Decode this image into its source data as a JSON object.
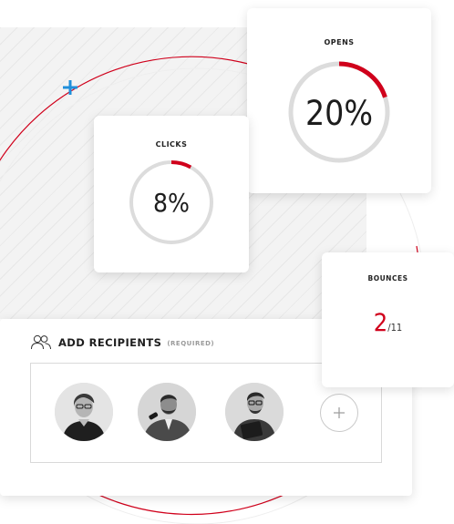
{
  "colors": {
    "accent": "#d0001b",
    "ring_track": "#dcdcdc",
    "cursor": "#1f8fdb"
  },
  "metrics": {
    "opens": {
      "label": "OPENS",
      "value": "20%",
      "fraction": 0.2
    },
    "clicks": {
      "label": "CLICKS",
      "value": "8%",
      "fraction": 0.08
    },
    "bounces": {
      "label": "BOUNCES",
      "count": "2",
      "total": "/11"
    }
  },
  "recipients": {
    "title": "ADD RECIPIENTS",
    "required": "(REQUIRED)",
    "icon": "users-icon",
    "avatars": [
      "woman-with-glasses",
      "man-with-microphone",
      "man-with-tablet"
    ],
    "add_icon": "plus-icon"
  }
}
